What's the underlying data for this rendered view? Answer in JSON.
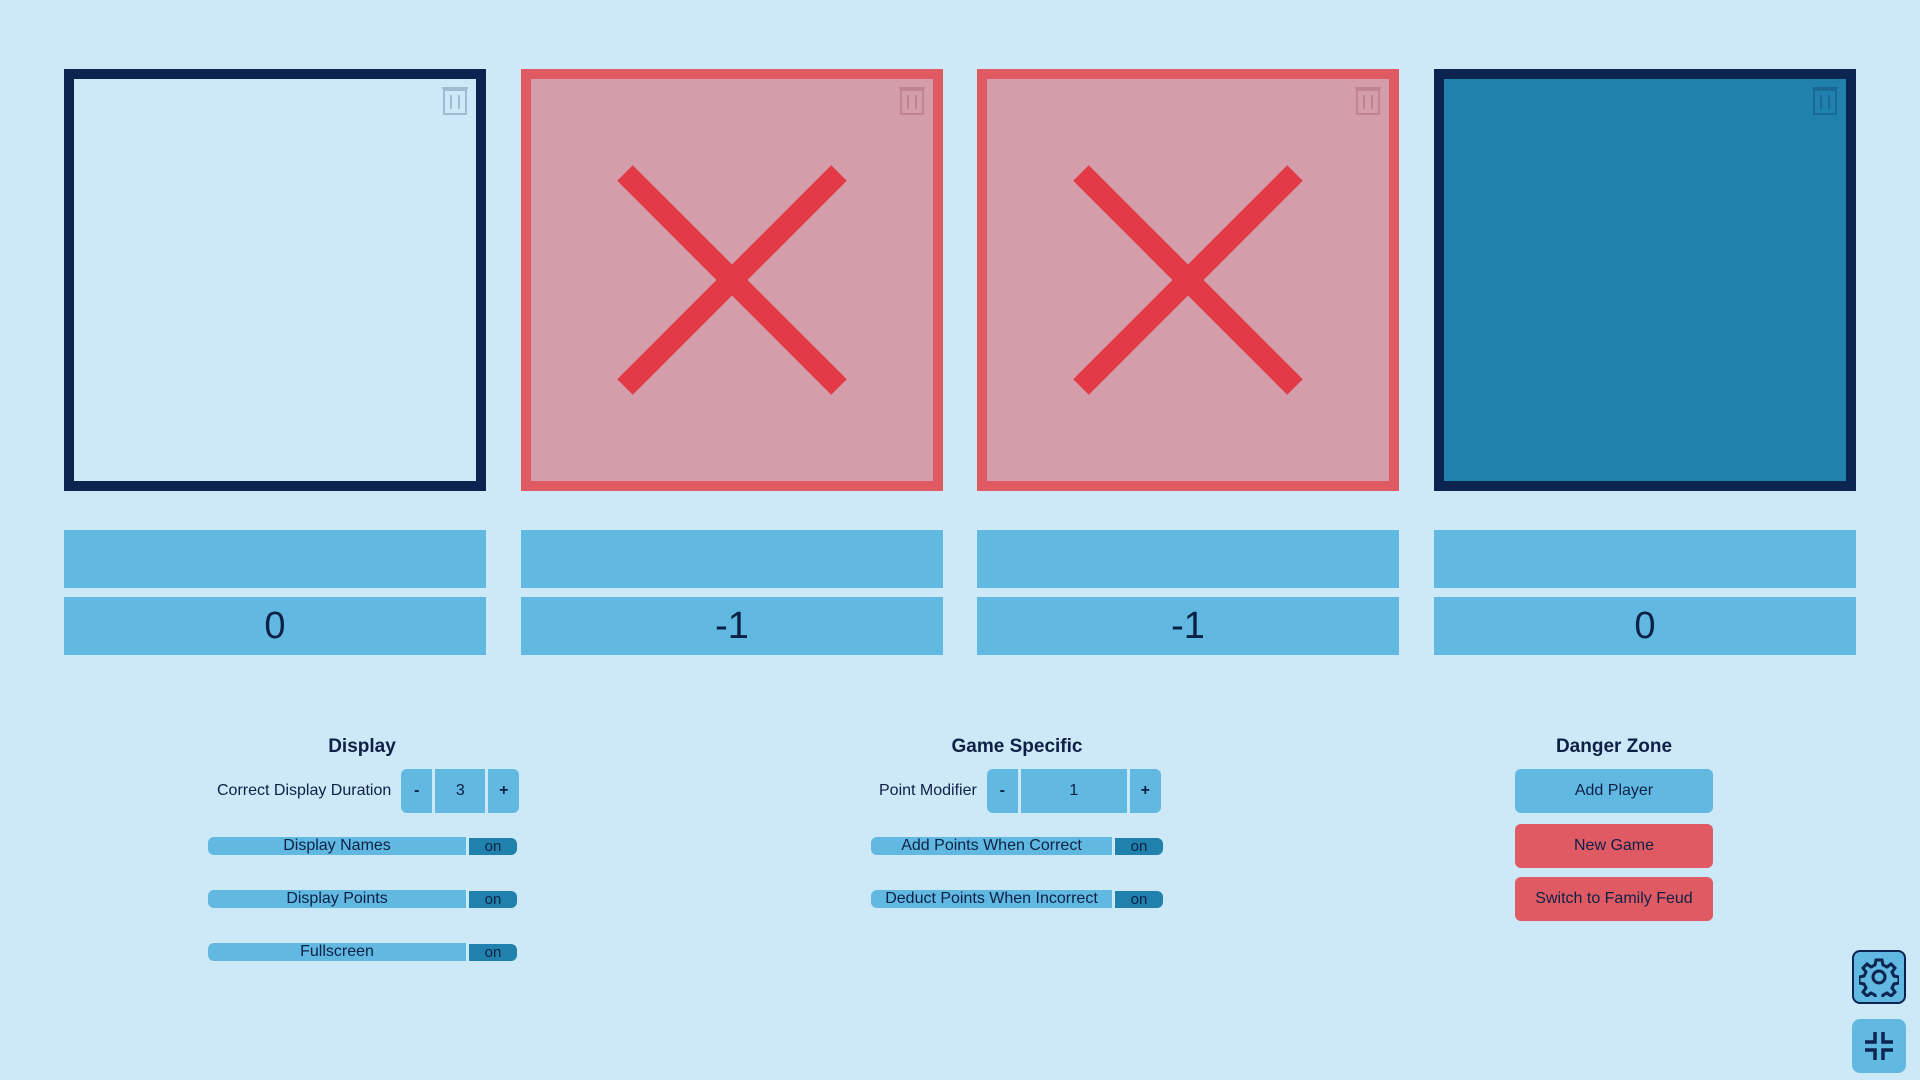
{
  "players": [
    {
      "state": "blank",
      "name": "",
      "points": "0"
    },
    {
      "state": "wrong",
      "name": "",
      "points": "-1"
    },
    {
      "state": "wrong",
      "name": "",
      "points": "-1"
    },
    {
      "state": "selected",
      "name": "",
      "points": "0"
    }
  ],
  "display": {
    "title": "Display",
    "duration_label": "Correct Display Duration",
    "duration_value": "3",
    "minus": "-",
    "plus": "+",
    "names_label": "Display Names",
    "names_state": "on",
    "points_label": "Display Points",
    "points_state": "on",
    "fullscreen_label": "Fullscreen",
    "fullscreen_state": "on"
  },
  "game": {
    "title": "Game Specific",
    "modifier_label": "Point Modifier",
    "modifier_value": "1",
    "minus": "-",
    "plus": "+",
    "add_label": "Add Points When Correct",
    "add_state": "on",
    "deduct_label": "Deduct Points When Incorrect",
    "deduct_state": "on"
  },
  "danger": {
    "title": "Danger Zone",
    "add_player": "Add Player",
    "new_game": "New Game",
    "switch": "Switch to Family Feud"
  },
  "colors": {
    "background": "#cde8f6",
    "button": "#61b8e0",
    "toggle_on": "#1f81ac",
    "danger": "#e05a63",
    "wrong_card": "#d49daa",
    "dark": "#0b2550"
  },
  "icons": [
    "trash-icon",
    "x-mark-icon",
    "gear-icon",
    "exit-fullscreen-icon"
  ]
}
